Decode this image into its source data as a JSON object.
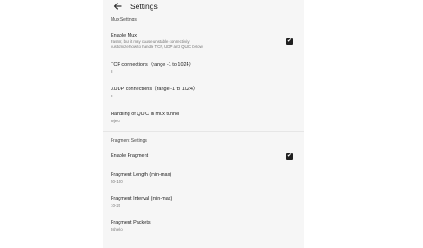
{
  "appbar": {
    "back_icon": "arrow-left-icon",
    "title": "Settings"
  },
  "mux": {
    "header": "Mux Settings",
    "enable": {
      "title": "Enable Mux",
      "summary_line1": "Faster, but it may cause unstable connectivity",
      "summary_line2": "customize how to handle TCP, UDP and QUIC below",
      "checked": true
    },
    "tcp": {
      "title": "TCP connections（range -1 to 1024）",
      "value": "8"
    },
    "xudp": {
      "title": "XUDP connections（range -1 to 1024）",
      "value": "8"
    },
    "quic": {
      "title": "Handling of QUIC in mux tunnel",
      "value": "reject"
    }
  },
  "fragment": {
    "header": "Fragment Settings",
    "enable": {
      "title": "Enable Fragment",
      "checked": true
    },
    "length": {
      "title": "Fragment Length (min-max)",
      "value": "50-100"
    },
    "interval": {
      "title": "Fragment Interval (min-max)",
      "value": "10-20"
    },
    "packets": {
      "title": "Fragment Packets",
      "value": "tlshello"
    }
  },
  "check_glyph": "✔"
}
